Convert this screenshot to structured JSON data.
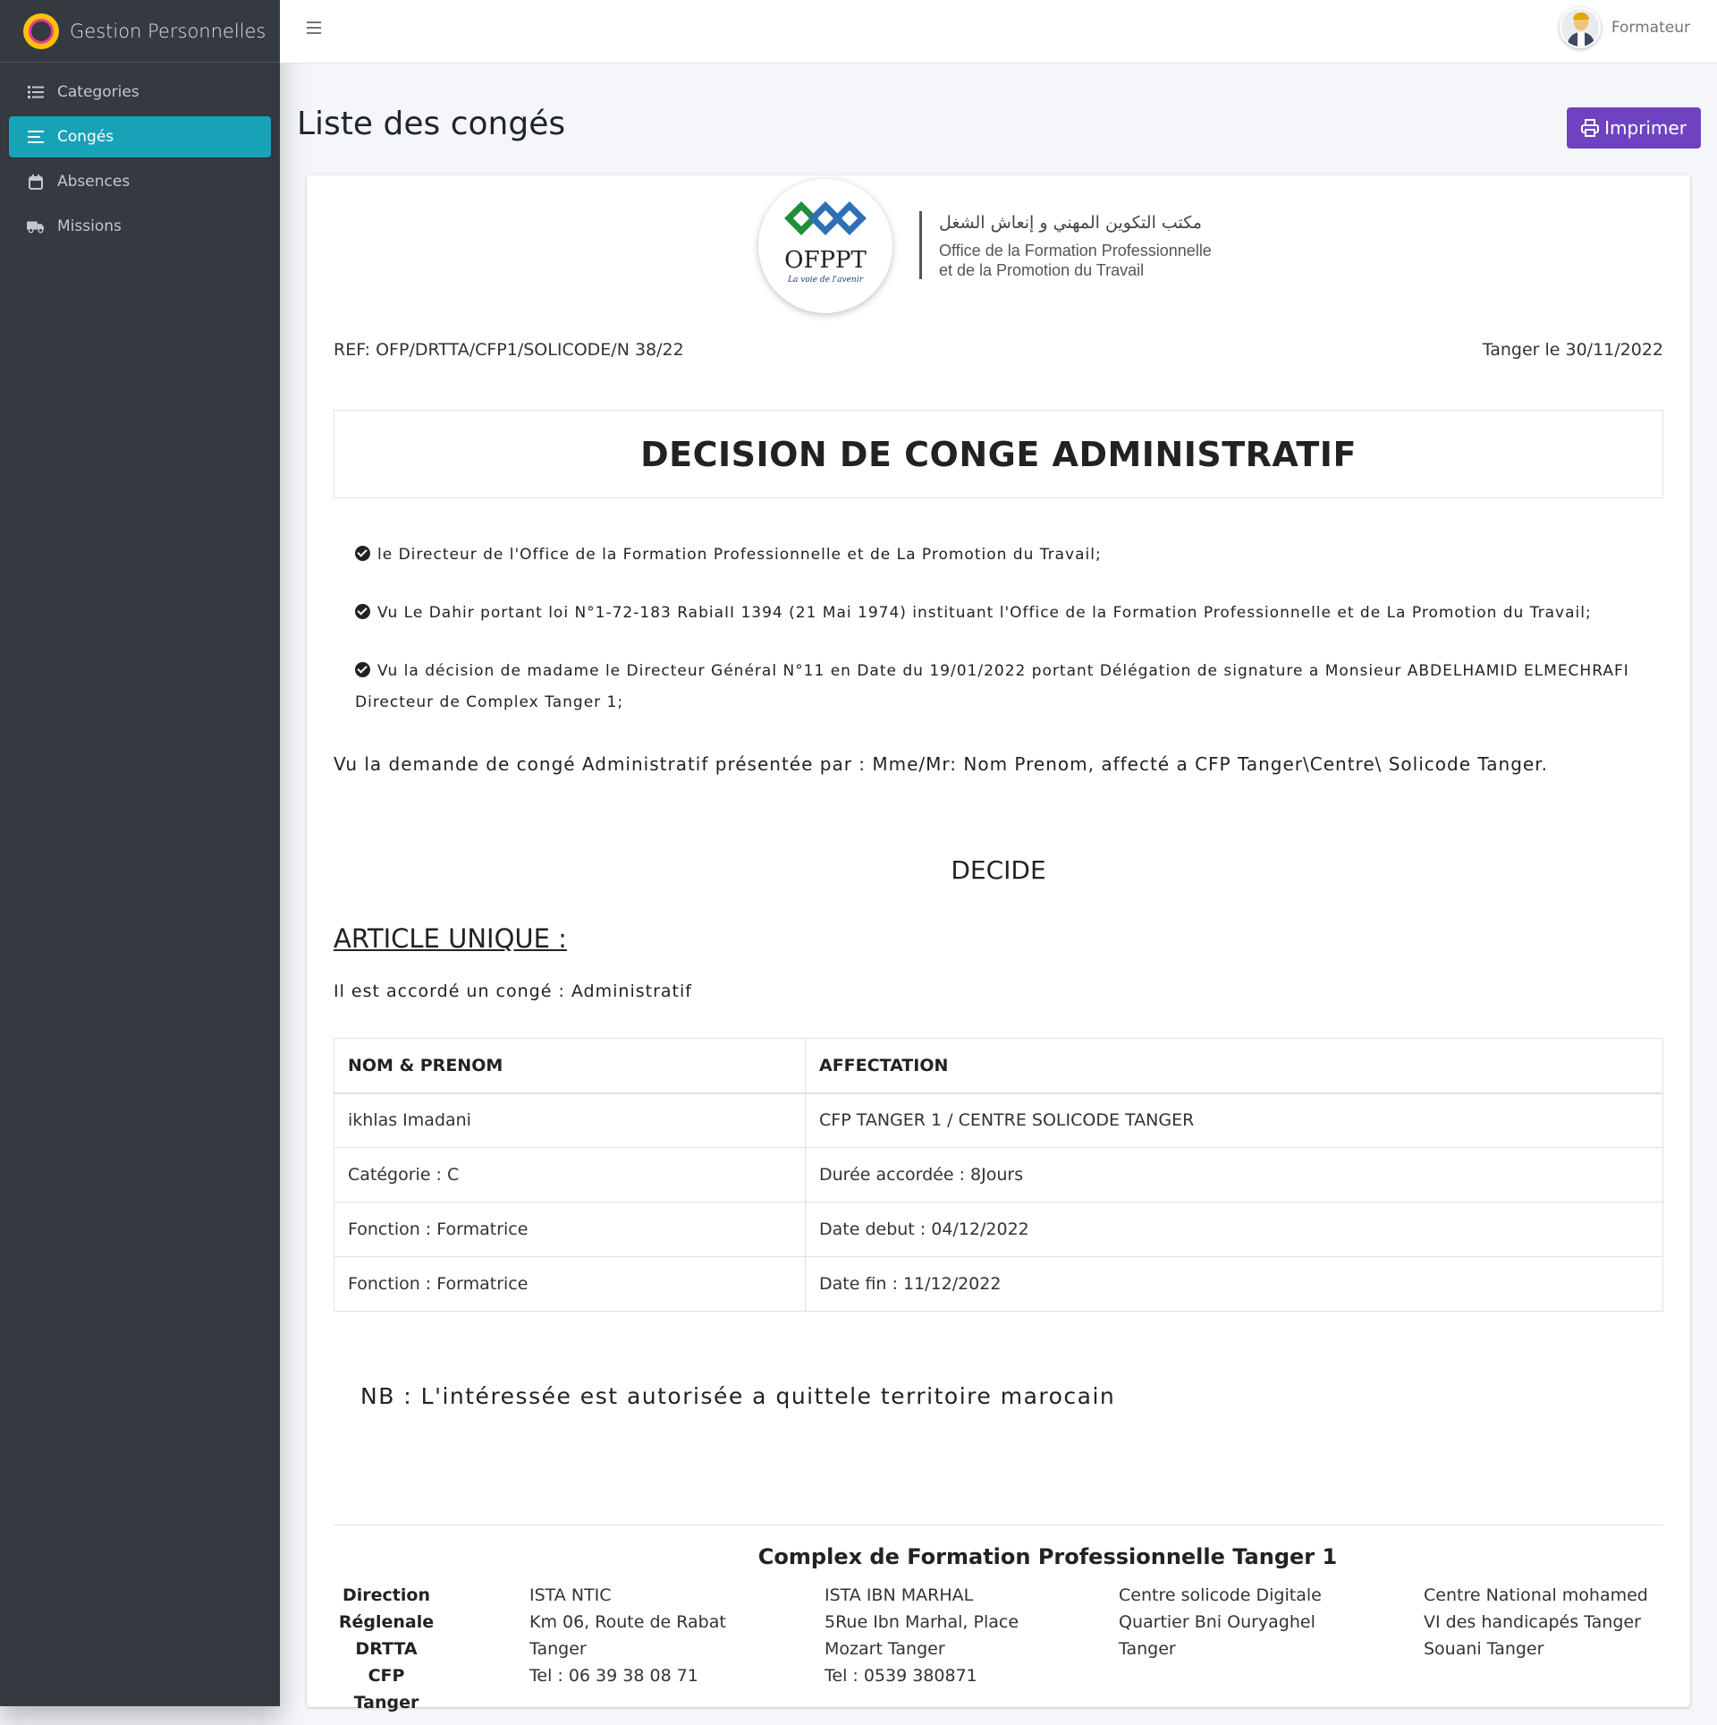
{
  "app": {
    "brand": "Gestion Personnelles"
  },
  "sidebar": {
    "items": [
      {
        "label": "Categories",
        "icon": "list-icon",
        "active": false
      },
      {
        "label": "Congés",
        "icon": "bars-icon",
        "active": true
      },
      {
        "label": "Absences",
        "icon": "calendar-icon",
        "active": false
      },
      {
        "label": "Missions",
        "icon": "truck-icon",
        "active": false
      }
    ]
  },
  "topbar": {
    "user_name": "Formateur"
  },
  "page": {
    "title": "Liste des congés",
    "print_label": "Imprimer"
  },
  "document": {
    "letterhead": {
      "logo_text": "OFPPT",
      "logo_tagline": "La voie de l'avenir",
      "arabic": "مكتب التكوين المهني و إنعاش الشغل",
      "fr_line1": "Office de la Formation Professionnelle",
      "fr_line2": "et de la Promotion du Travail"
    },
    "ref": "REF: OFP/DRTTA/CFP1/SOLICODE/N 38/22",
    "date": "Tanger le 30/11/2022",
    "title": "DECISION DE CONGE ADMINISTRATIF",
    "vu": [
      "le Directeur de l'Office de la Formation Professionnelle et de La Promotion du Travail;",
      "Vu Le Dahir portant loi N°1-72-183 RabiaII 1394 (21 Mai 1974) instituant l'Office de la Formation Professionnelle et de La Promotion du Travail;",
      "Vu la décision de madame le Directeur Général N°11 en Date du 19/01/2022 portant Délégation de signature a Monsieur ABDELHAMID ELMECHRAFI Directeur de Complex Tanger 1;"
    ],
    "demande": "Vu la demande de congé Administratif présentée par : Mme/Mr: Nom Prenom, affecté a CFP Tanger\\Centre\\ Solicode Tanger.",
    "decide": "DECIDE",
    "article": "ARTICLE UNIQUE :",
    "accorde": "Il est accordé un congé : Administratif",
    "table": {
      "headers": [
        "NOM & PRENOM",
        "AFFECTATION"
      ],
      "rows": [
        [
          "ikhlas Imadani",
          "CFP TANGER 1 / CENTRE SOLICODE TANGER"
        ],
        [
          "Catégorie : C",
          "Durée accordée : 8Jours"
        ],
        [
          "Fonction : Formatrice",
          "Date debut : 04/12/2022"
        ],
        [
          "Fonction : Formatrice",
          "Date fin : 11/12/2022"
        ]
      ]
    },
    "nb": "NB : L'intéressée est autorisée a quittele territoire marocain",
    "footer": {
      "title": "Complex de Formation Professionnelle Tanger 1",
      "direction": [
        "Direction",
        "Réglenale",
        "DRTTA",
        "CFP Tanger"
      ],
      "col1": [
        "ISTA NTIC",
        "Km 06, Route de Rabat",
        "Tanger",
        "Tel : 06 39 38 08 71"
      ],
      "col2": [
        "ISTA IBN MARHAL",
        "5Rue Ibn Marhal, Place",
        "Mozart Tanger",
        "Tel : 0539 380871"
      ],
      "col3": [
        "Centre solicode Digitale",
        "Quartier Bni Ouryaghel",
        "Tanger"
      ],
      "col4": [
        "Centre National mohamed",
        "VI des handicapés Tanger",
        "Souani Tanger"
      ]
    }
  },
  "colors": {
    "sidebar_bg": "#343a40",
    "active_nav": "#17a2b8",
    "print_button": "#6f42c1"
  }
}
